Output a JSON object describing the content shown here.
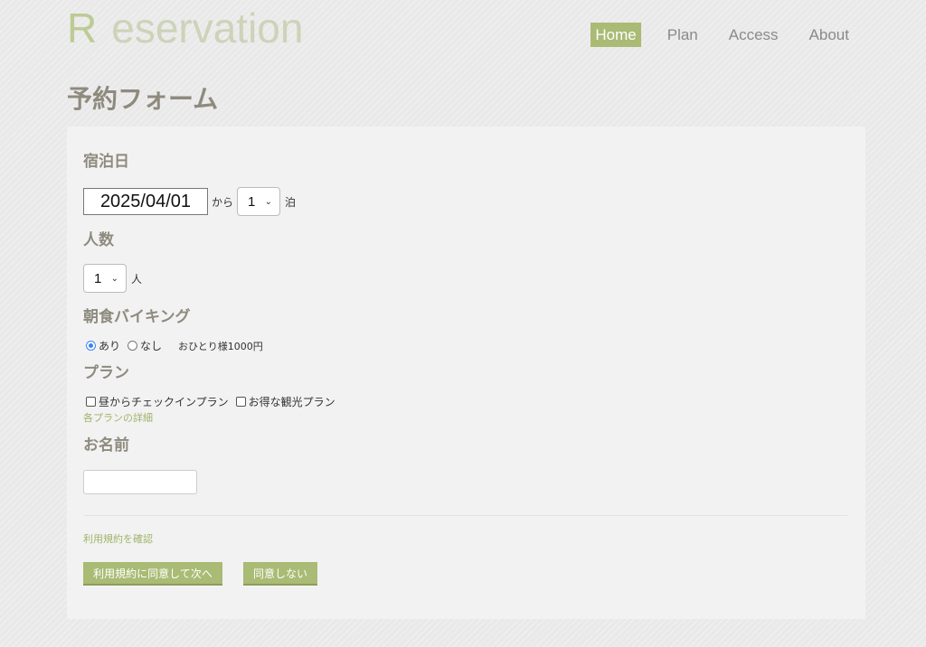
{
  "header": {
    "logo_first": "R",
    "logo_rest": "eservation",
    "nav": [
      {
        "label": "Home",
        "active": true
      },
      {
        "label": "Plan",
        "active": false
      },
      {
        "label": "Access",
        "active": false
      },
      {
        "label": "About",
        "active": false
      }
    ]
  },
  "page_title": "予約フォーム",
  "form": {
    "stay": {
      "heading": "宿泊日",
      "date_value": "2025/04/01",
      "from_label": "から",
      "nights_value": "1",
      "nights_unit": "泊"
    },
    "people": {
      "heading": "人数",
      "count_value": "1",
      "unit": "人"
    },
    "breakfast": {
      "heading": "朝食バイキング",
      "option_yes": "あり",
      "option_no": "なし",
      "selected": "あり",
      "note": "おひとり様1000円"
    },
    "plan": {
      "heading": "プラン",
      "option_1": "昼からチェックインプラン",
      "option_2": "お得な観光プラン",
      "details_link": "各プランの詳細"
    },
    "name": {
      "heading": "お名前",
      "value": ""
    },
    "terms_link": "利用規約を確認",
    "agree_button": "利用規約に同意して次へ",
    "disagree_button": "同意しない"
  }
}
